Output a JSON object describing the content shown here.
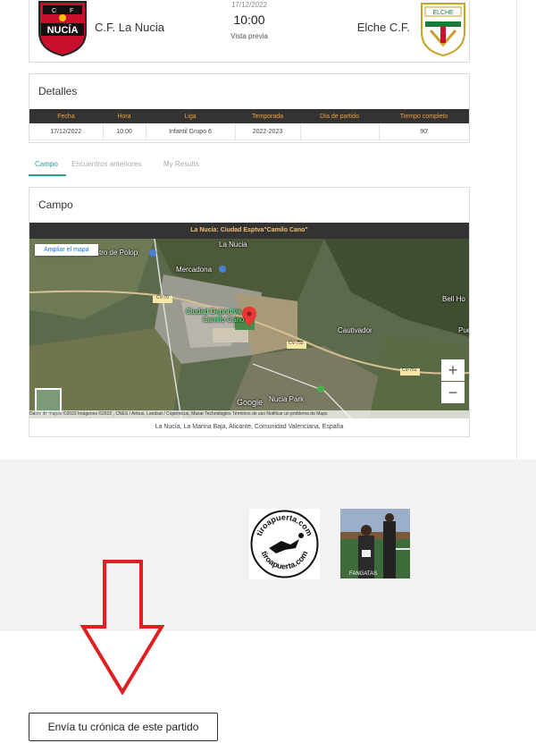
{
  "match": {
    "date": "17/12/2022",
    "time": "10:00",
    "status": "Vista previa",
    "home_team": "C.F. La Nucia",
    "away_team": "Elche C.F."
  },
  "details": {
    "title": "Detalles",
    "headers": [
      "Fecha",
      "Hora",
      "Liga",
      "Temporada",
      "Día de partido",
      "Tiempo completo"
    ],
    "row": [
      "17/12/2022",
      "10:00",
      "Infantil Grupo 6",
      "2022-2023",
      "",
      "90'"
    ]
  },
  "tabs": [
    {
      "label": "Campo",
      "active": true
    },
    {
      "label": "Encuentros anteriores",
      "active": false
    },
    {
      "label": "My Results",
      "active": false
    }
  ],
  "campo": {
    "title": "Campo",
    "venue": "La Nucía: Ciudad Esptva\"Camilo Cano\"",
    "address": "La Nucía, La Marina Baja, Alicante, Comunidad Valenciana, España",
    "map": {
      "ampliar": "Ampliar el mapa",
      "zoom_in": "+",
      "zoom_out": "−",
      "labels": {
        "polop": "stro de Polop",
        "mercadona": "Mercadona",
        "la_nucia": "La Nucia",
        "ciudad_deportiva": "Ciudad Deportiva",
        "camilo_cano": "Camilo Cano",
        "cautivador": "Cautivador",
        "nucia_park": "Nucia Park",
        "bell_ho": "Bell Ho",
        "cv70": "CV-70",
        "cv755": "CV-755",
        "cv751": "CV-751",
        "puerto": "Pue"
      },
      "attribution": "Datos de mapas ©2022 Imágenes ©2022 , CNES / Airbus, Landsat / Copernicus, Maxar Technologies    Términos de uso    Notificar un problema de Maps",
      "google": "Google"
    }
  },
  "sponsors": {
    "tiroapuerta_top": "tiroapuerta.com",
    "tiroapuerta_bottom": "tiroapuerta.com",
    "photo_caption": "FANGATAS"
  },
  "cta": {
    "label": "Envía tu crónica de este partido"
  },
  "colors": {
    "header_bg": "#333333",
    "header_text": "#f0a040",
    "accent": "#2a9d8f",
    "arrow": "#e02020"
  }
}
